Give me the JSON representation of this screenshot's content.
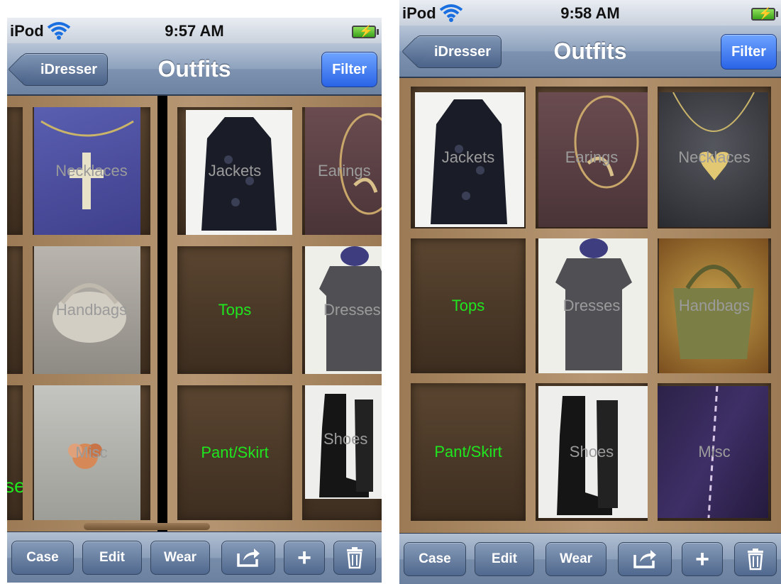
{
  "left": {
    "status": {
      "carrier": "iPod",
      "time": "9:57 AM"
    },
    "nav": {
      "back": "iDresser",
      "title": "Outfits",
      "filter": "Filter"
    },
    "partial_label": "se",
    "cells": [
      {
        "label": "Necklaces",
        "color": "gray",
        "photo": "blue-cross-necklace"
      },
      {
        "label": "Jackets",
        "color": "gray",
        "photo": "black-jacket"
      },
      {
        "label": "Earings",
        "color": "gray",
        "photo": "gold-earring"
      },
      {
        "label": "Handbags",
        "color": "gray",
        "photo": "gray-handbag"
      },
      {
        "label": "Tops",
        "color": "green",
        "photo": ""
      },
      {
        "label": "Dresses",
        "color": "gray",
        "photo": "gray-dress"
      },
      {
        "label": "Misc",
        "color": "gray",
        "photo": "flower-ring"
      },
      {
        "label": "Pant/Skirt",
        "color": "green",
        "photo": ""
      },
      {
        "label": "Shoes",
        "color": "gray",
        "photo": "black-boots"
      }
    ],
    "toolbar": {
      "case": "Case",
      "edit": "Edit",
      "wear": "Wear"
    }
  },
  "right": {
    "status": {
      "carrier": "iPod",
      "time": "9:58 AM"
    },
    "nav": {
      "back": "iDresser",
      "title": "Outfits",
      "filter": "Filter"
    },
    "cells": [
      {
        "label": "Jackets",
        "color": "gray",
        "photo": "black-jacket"
      },
      {
        "label": "Earings",
        "color": "gray",
        "photo": "gold-earring"
      },
      {
        "label": "Necklaces",
        "color": "gray",
        "photo": "gold-heart-necklace"
      },
      {
        "label": "Tops",
        "color": "green",
        "photo": ""
      },
      {
        "label": "Dresses",
        "color": "gray",
        "photo": "gray-dress"
      },
      {
        "label": "Handbags",
        "color": "gray",
        "photo": "olive-handbag"
      },
      {
        "label": "Pant/Skirt",
        "color": "green",
        "photo": ""
      },
      {
        "label": "Shoes",
        "color": "gray",
        "photo": "black-boots"
      },
      {
        "label": "Misc",
        "color": "gray",
        "photo": "purple-tights"
      }
    ],
    "toolbar": {
      "case": "Case",
      "edit": "Edit",
      "wear": "Wear"
    }
  },
  "colors": {
    "green_label": "#1fe61f",
    "gray_label": "#9b9b9b",
    "filter_button": "#2a64e6",
    "shelf_wood": "#a88762"
  },
  "icons": [
    "wifi-icon",
    "battery-icon",
    "share-icon",
    "add-icon",
    "trash-icon"
  ]
}
